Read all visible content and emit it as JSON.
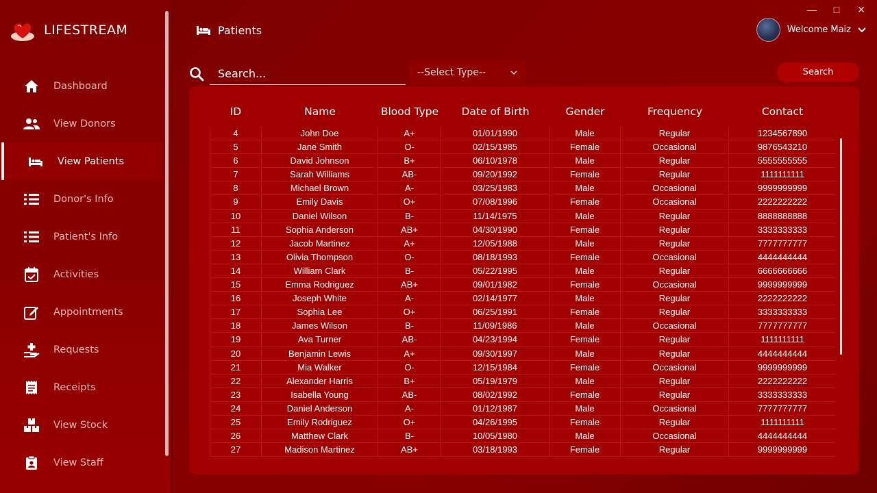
{
  "app": {
    "name": "LIFESTREAM"
  },
  "sidebar": {
    "items": [
      {
        "label": "Dashboard",
        "icon": "home-icon"
      },
      {
        "label": "View Donors",
        "icon": "users-icon"
      },
      {
        "label": "View Patients",
        "icon": "bed-icon",
        "active": true
      },
      {
        "label": "Donor's Info",
        "icon": "list-icon"
      },
      {
        "label": "Patient's Info",
        "icon": "list-icon"
      },
      {
        "label": "Activities",
        "icon": "calendar-check-icon"
      },
      {
        "label": "Appointments",
        "icon": "edit-icon"
      },
      {
        "label": "Requests",
        "icon": "hand-plus-icon"
      },
      {
        "label": "Receipts",
        "icon": "receipt-icon"
      },
      {
        "label": "View Stock",
        "icon": "boxes-icon"
      },
      {
        "label": "View Staff",
        "icon": "clipboard-user-icon"
      }
    ]
  },
  "header": {
    "title": "Patients",
    "user": "Welcome Maiz"
  },
  "search": {
    "placeholder": "Search...",
    "select_label": "--Select Type--",
    "button_label": "Search"
  },
  "table": {
    "columns": [
      "ID",
      "Name",
      "Blood Type",
      "Date of Birth",
      "Gender",
      "Frequency",
      "Contact"
    ],
    "rows": [
      [
        "4",
        "John Doe",
        "A+",
        "01/01/1990",
        "Male",
        "Regular",
        "1234567890"
      ],
      [
        "5",
        "Jane Smith",
        "O-",
        "02/15/1985",
        "Female",
        "Occasional",
        "9876543210"
      ],
      [
        "6",
        "David Johnson",
        "B+",
        "06/10/1978",
        "Male",
        "Regular",
        "5555555555"
      ],
      [
        "7",
        "Sarah Williams",
        "AB-",
        "09/20/1992",
        "Female",
        "Regular",
        "1111111111"
      ],
      [
        "8",
        "Michael Brown",
        "A-",
        "03/25/1983",
        "Male",
        "Occasional",
        "9999999999"
      ],
      [
        "9",
        "Emily Davis",
        "O+",
        "07/08/1996",
        "Female",
        "Occasional",
        "2222222222"
      ],
      [
        "10",
        "Daniel Wilson",
        "B-",
        "11/14/1975",
        "Male",
        "Regular",
        "8888888888"
      ],
      [
        "11",
        "Sophia Anderson",
        "AB+",
        "04/30/1990",
        "Female",
        "Regular",
        "3333333333"
      ],
      [
        "12",
        "Jacob Martinez",
        "A+",
        "12/05/1988",
        "Male",
        "Regular",
        "7777777777"
      ],
      [
        "13",
        "Olivia Thompson",
        "O-",
        "08/18/1993",
        "Female",
        "Occasional",
        "4444444444"
      ],
      [
        "14",
        "William Clark",
        "B-",
        "05/22/1995",
        "Male",
        "Regular",
        "6666666666"
      ],
      [
        "15",
        "Emma Rodriguez",
        "AB+",
        "09/01/1982",
        "Female",
        "Occasional",
        "9999999999"
      ],
      [
        "16",
        "Joseph White",
        "A-",
        "02/14/1977",
        "Male",
        "Regular",
        "2222222222"
      ],
      [
        "17",
        "Sophia Lee",
        "O+",
        "06/25/1991",
        "Female",
        "Regular",
        "3333333333"
      ],
      [
        "18",
        "James Wilson",
        "B-",
        "11/09/1986",
        "Male",
        "Occasional",
        "7777777777"
      ],
      [
        "19",
        "Ava Turner",
        "AB-",
        "04/23/1994",
        "Female",
        "Regular",
        "1111111111"
      ],
      [
        "20",
        "Benjamin Lewis",
        "A+",
        "09/30/1997",
        "Male",
        "Regular",
        "4444444444"
      ],
      [
        "21",
        "Mia Walker",
        "O-",
        "12/15/1984",
        "Female",
        "Occasional",
        "9999999999"
      ],
      [
        "22",
        "Alexander Harris",
        "B+",
        "05/19/1979",
        "Male",
        "Regular",
        "2222222222"
      ],
      [
        "23",
        "Isabella Young",
        "AB-",
        "08/02/1992",
        "Female",
        "Regular",
        "3333333333"
      ],
      [
        "24",
        "Daniel Anderson",
        "A-",
        "01/12/1987",
        "Male",
        "Occasional",
        "7777777777"
      ],
      [
        "25",
        "Emily Rodriguez",
        "O+",
        "04/26/1995",
        "Female",
        "Regular",
        "1111111111"
      ],
      [
        "26",
        "Matthew Clark",
        "B-",
        "10/05/1980",
        "Male",
        "Occasional",
        "4444444444"
      ],
      [
        "27",
        "Madison Martinez",
        "AB+",
        "03/18/1993",
        "Female",
        "Regular",
        "9999999999"
      ]
    ]
  },
  "colors": {
    "sidebar": "#820000",
    "main": "#7c0000",
    "card": "#a00000",
    "accent": "#b00000"
  }
}
